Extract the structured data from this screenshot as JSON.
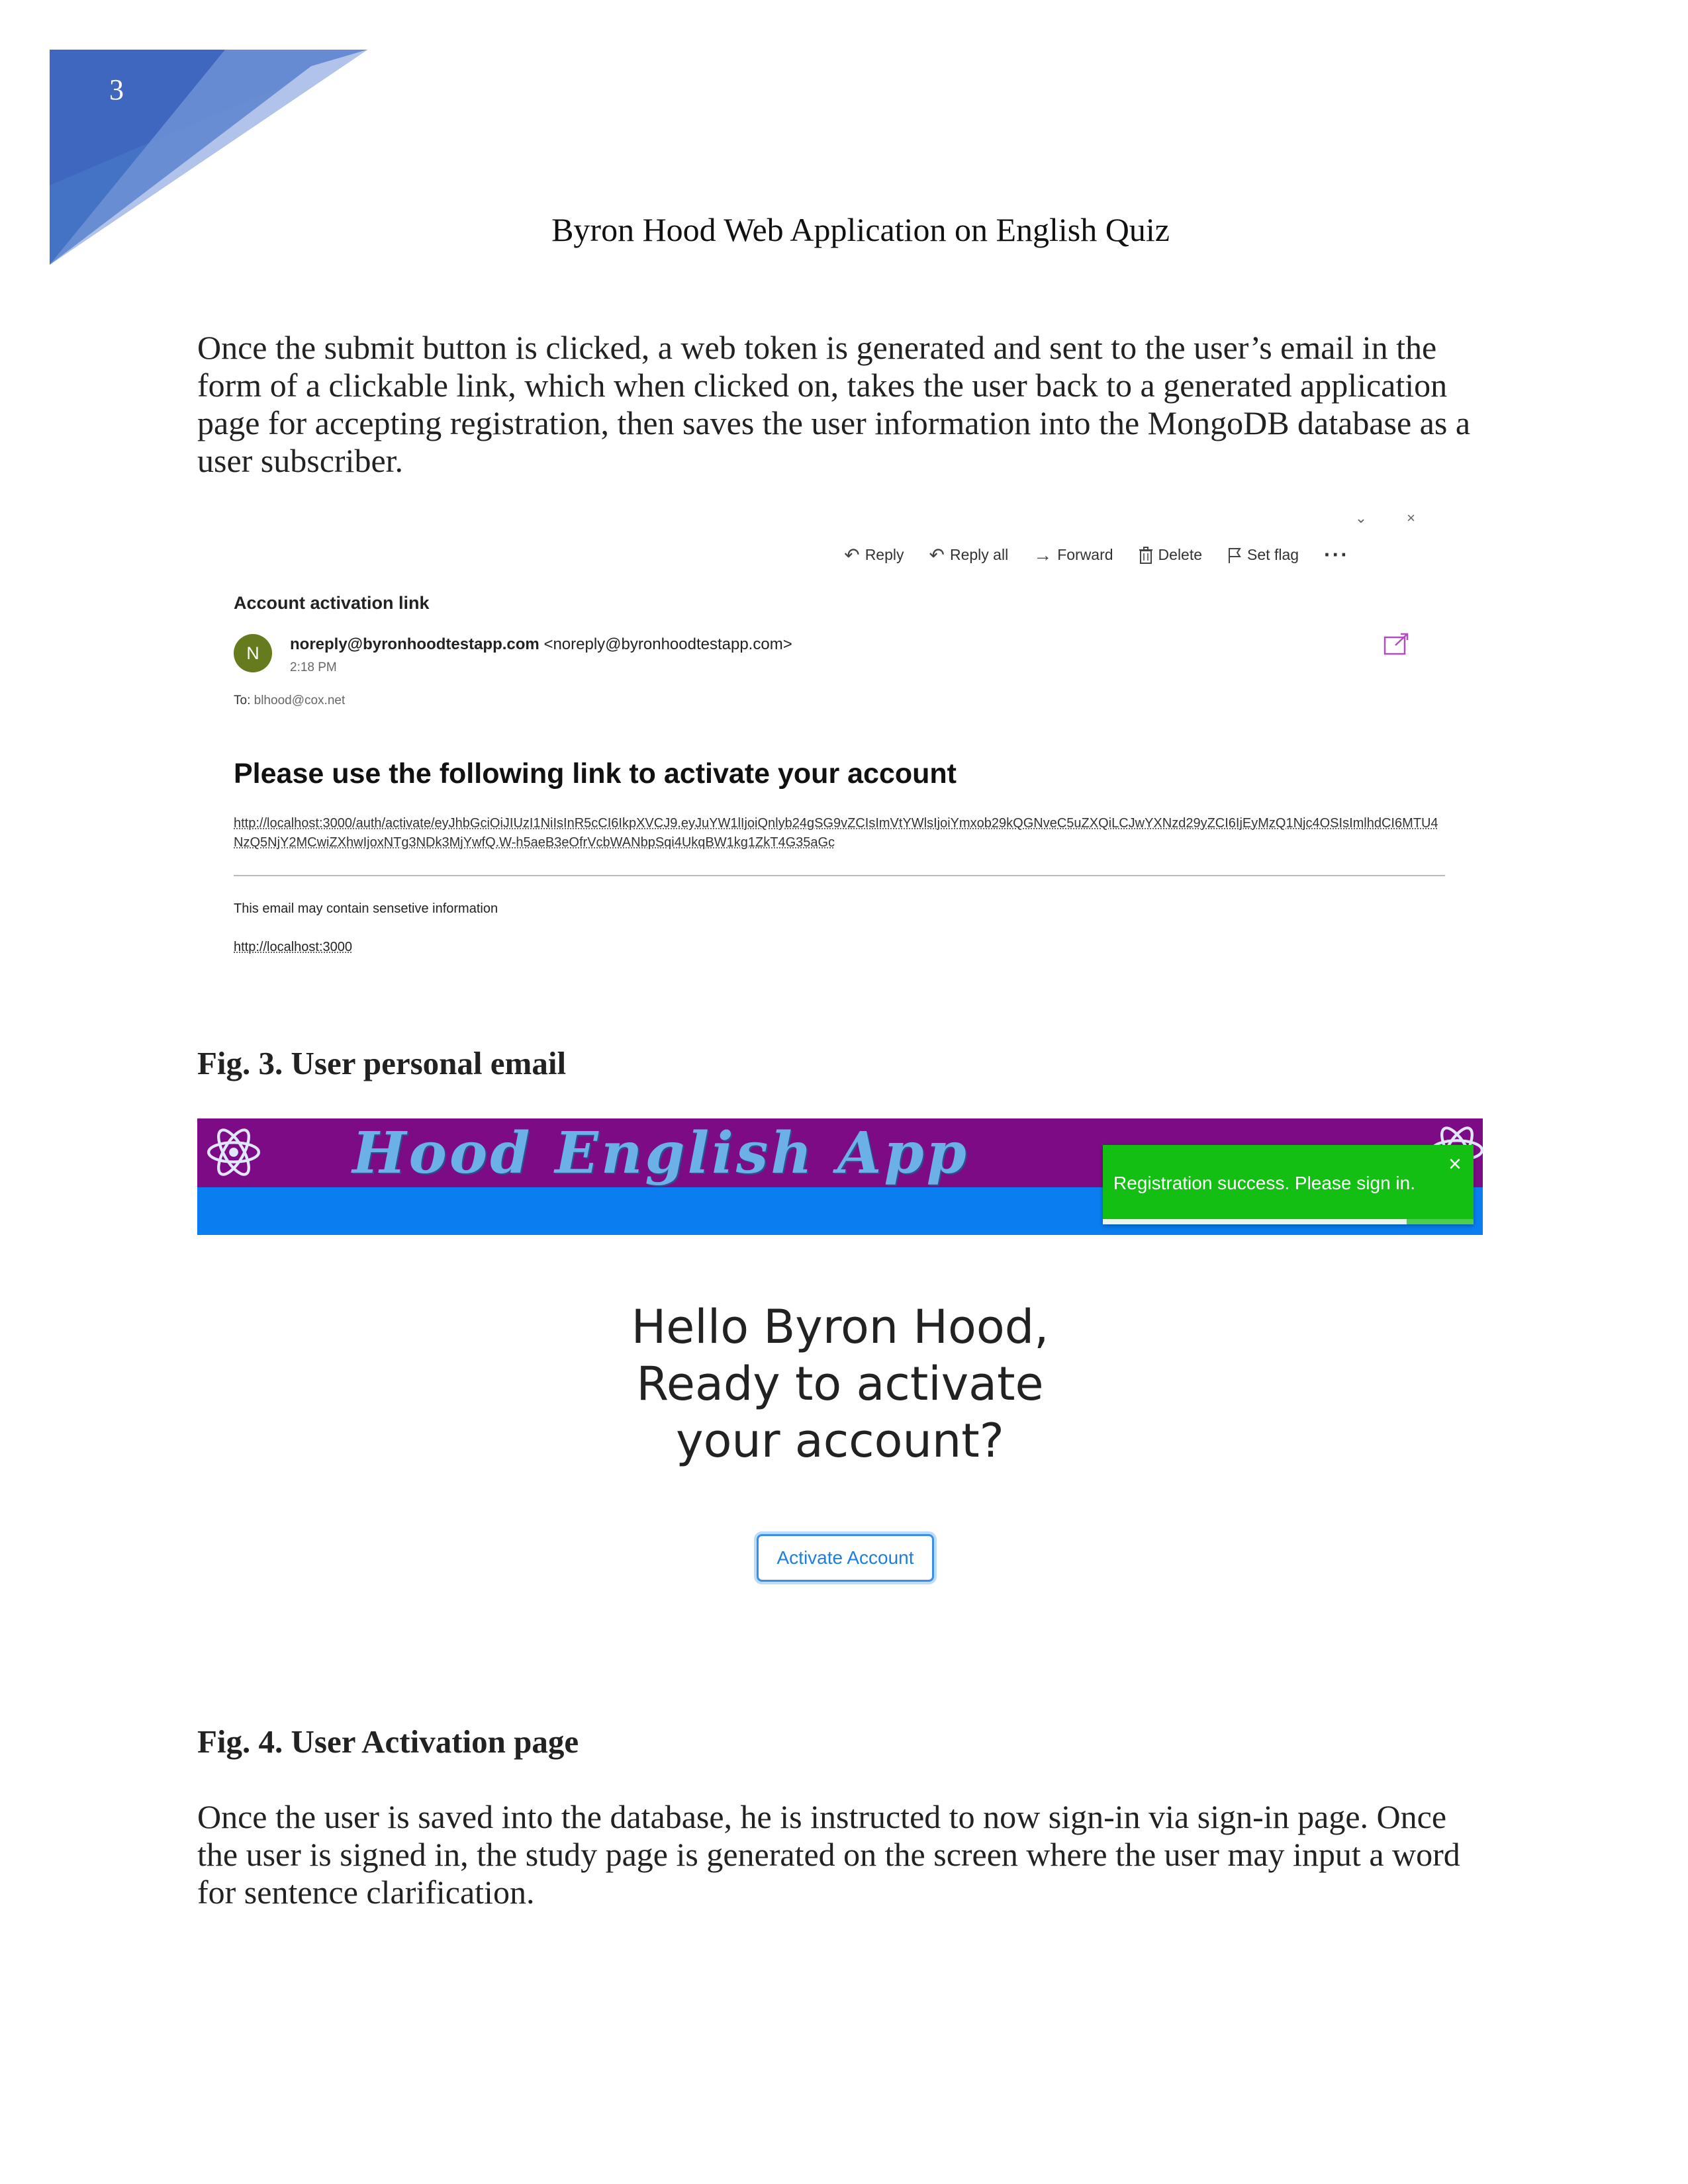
{
  "page": {
    "number": "3",
    "header_title": "Byron Hood Web Application on English Quiz",
    "intro_paragraph": "Once the submit button is clicked, a web token is generated and sent to the user’s email in the form of a clickable link, which when clicked on, takes the user back to a generated application page for accepting registration, then saves the user information into the MongoDB database as a user subscriber.",
    "fig3_caption": "Fig. 3. User personal email",
    "fig4_caption": "Fig. 4. User Activation page",
    "closing_paragraph": "Once the user is saved into the database, he is instructed to now sign-in via sign-in page. Once the user is signed in, the study page is generated on the screen where the user may input a word for sentence clarification."
  },
  "email": {
    "toolbar": {
      "reply": "Reply",
      "reply_all": "Reply all",
      "forward": "Forward",
      "delete": "Delete",
      "set_flag": "Set flag",
      "more": "···"
    },
    "subject": "Account activation link",
    "avatar_letter": "N",
    "sender_name": "noreply@byronhoodtestapp.com",
    "sender_address": "<noreply@byronhoodtestapp.com>",
    "time": "2:18 PM",
    "to_label": "To:",
    "to_address": "blhood@cox.net",
    "heading": "Please use the following link to activate your account",
    "activation_link": "http://localhost:3000/auth/activate/eyJhbGciOiJIUzI1NiIsInR5cCI6IkpXVCJ9.eyJuYW1lIjoiQnlyb24gSG9vZCIsImVtYWlsIjoiYmxob29kQGNveC5uZXQiLCJwYXNzd29yZCI6IjEyMzQ1Njc4OSIsImlhdCI6MTU4NzQ5NjY2MCwiZXhwIjoxNTg3NDk3MjYwfQ.W-h5aeB3eOfrVcbWANbpSqi4UkqBW1kg1ZkT4G35aGc",
    "disclaimer": "This email may contain sensetive information",
    "footer_link": "http://localhost:3000"
  },
  "app": {
    "title": "Hood English App",
    "toast": {
      "message": "Registration success. Please sign in.",
      "close": "×",
      "progress": 0.82
    },
    "greeting_line1": "Hello Byron Hood,",
    "greeting_line2": "Ready to activate",
    "greeting_line3": "your account?",
    "activate_button": "Activate Account"
  },
  "colors": {
    "titlebar": "#7d0b86",
    "bluebar": "#0a7df0",
    "toast": "#12bf12",
    "avatar": "#667a1e",
    "corner_blue": "#4472c4"
  }
}
